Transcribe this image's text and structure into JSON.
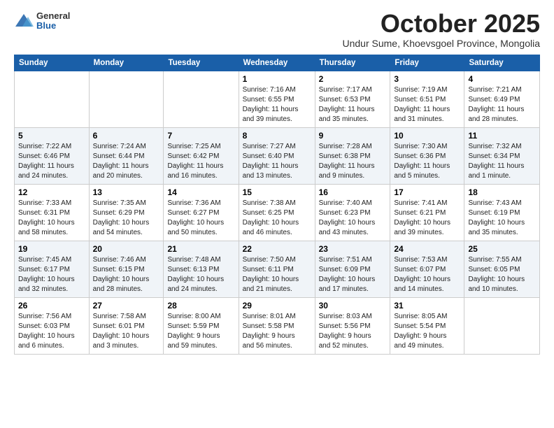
{
  "logo": {
    "general": "General",
    "blue": "Blue"
  },
  "title": "October 2025",
  "subtitle": "Undur Sume, Khoevsgoel Province, Mongolia",
  "weekdays": [
    "Sunday",
    "Monday",
    "Tuesday",
    "Wednesday",
    "Thursday",
    "Friday",
    "Saturday"
  ],
  "weeks": [
    [
      {
        "day": "",
        "info": ""
      },
      {
        "day": "",
        "info": ""
      },
      {
        "day": "",
        "info": ""
      },
      {
        "day": "1",
        "info": "Sunrise: 7:16 AM\nSunset: 6:55 PM\nDaylight: 11 hours\nand 39 minutes."
      },
      {
        "day": "2",
        "info": "Sunrise: 7:17 AM\nSunset: 6:53 PM\nDaylight: 11 hours\nand 35 minutes."
      },
      {
        "day": "3",
        "info": "Sunrise: 7:19 AM\nSunset: 6:51 PM\nDaylight: 11 hours\nand 31 minutes."
      },
      {
        "day": "4",
        "info": "Sunrise: 7:21 AM\nSunset: 6:49 PM\nDaylight: 11 hours\nand 28 minutes."
      }
    ],
    [
      {
        "day": "5",
        "info": "Sunrise: 7:22 AM\nSunset: 6:46 PM\nDaylight: 11 hours\nand 24 minutes."
      },
      {
        "day": "6",
        "info": "Sunrise: 7:24 AM\nSunset: 6:44 PM\nDaylight: 11 hours\nand 20 minutes."
      },
      {
        "day": "7",
        "info": "Sunrise: 7:25 AM\nSunset: 6:42 PM\nDaylight: 11 hours\nand 16 minutes."
      },
      {
        "day": "8",
        "info": "Sunrise: 7:27 AM\nSunset: 6:40 PM\nDaylight: 11 hours\nand 13 minutes."
      },
      {
        "day": "9",
        "info": "Sunrise: 7:28 AM\nSunset: 6:38 PM\nDaylight: 11 hours\nand 9 minutes."
      },
      {
        "day": "10",
        "info": "Sunrise: 7:30 AM\nSunset: 6:36 PM\nDaylight: 11 hours\nand 5 minutes."
      },
      {
        "day": "11",
        "info": "Sunrise: 7:32 AM\nSunset: 6:34 PM\nDaylight: 11 hours\nand 1 minute."
      }
    ],
    [
      {
        "day": "12",
        "info": "Sunrise: 7:33 AM\nSunset: 6:31 PM\nDaylight: 10 hours\nand 58 minutes."
      },
      {
        "day": "13",
        "info": "Sunrise: 7:35 AM\nSunset: 6:29 PM\nDaylight: 10 hours\nand 54 minutes."
      },
      {
        "day": "14",
        "info": "Sunrise: 7:36 AM\nSunset: 6:27 PM\nDaylight: 10 hours\nand 50 minutes."
      },
      {
        "day": "15",
        "info": "Sunrise: 7:38 AM\nSunset: 6:25 PM\nDaylight: 10 hours\nand 46 minutes."
      },
      {
        "day": "16",
        "info": "Sunrise: 7:40 AM\nSunset: 6:23 PM\nDaylight: 10 hours\nand 43 minutes."
      },
      {
        "day": "17",
        "info": "Sunrise: 7:41 AM\nSunset: 6:21 PM\nDaylight: 10 hours\nand 39 minutes."
      },
      {
        "day": "18",
        "info": "Sunrise: 7:43 AM\nSunset: 6:19 PM\nDaylight: 10 hours\nand 35 minutes."
      }
    ],
    [
      {
        "day": "19",
        "info": "Sunrise: 7:45 AM\nSunset: 6:17 PM\nDaylight: 10 hours\nand 32 minutes."
      },
      {
        "day": "20",
        "info": "Sunrise: 7:46 AM\nSunset: 6:15 PM\nDaylight: 10 hours\nand 28 minutes."
      },
      {
        "day": "21",
        "info": "Sunrise: 7:48 AM\nSunset: 6:13 PM\nDaylight: 10 hours\nand 24 minutes."
      },
      {
        "day": "22",
        "info": "Sunrise: 7:50 AM\nSunset: 6:11 PM\nDaylight: 10 hours\nand 21 minutes."
      },
      {
        "day": "23",
        "info": "Sunrise: 7:51 AM\nSunset: 6:09 PM\nDaylight: 10 hours\nand 17 minutes."
      },
      {
        "day": "24",
        "info": "Sunrise: 7:53 AM\nSunset: 6:07 PM\nDaylight: 10 hours\nand 14 minutes."
      },
      {
        "day": "25",
        "info": "Sunrise: 7:55 AM\nSunset: 6:05 PM\nDaylight: 10 hours\nand 10 minutes."
      }
    ],
    [
      {
        "day": "26",
        "info": "Sunrise: 7:56 AM\nSunset: 6:03 PM\nDaylight: 10 hours\nand 6 minutes."
      },
      {
        "day": "27",
        "info": "Sunrise: 7:58 AM\nSunset: 6:01 PM\nDaylight: 10 hours\nand 3 minutes."
      },
      {
        "day": "28",
        "info": "Sunrise: 8:00 AM\nSunset: 5:59 PM\nDaylight: 9 hours\nand 59 minutes."
      },
      {
        "day": "29",
        "info": "Sunrise: 8:01 AM\nSunset: 5:58 PM\nDaylight: 9 hours\nand 56 minutes."
      },
      {
        "day": "30",
        "info": "Sunrise: 8:03 AM\nSunset: 5:56 PM\nDaylight: 9 hours\nand 52 minutes."
      },
      {
        "day": "31",
        "info": "Sunrise: 8:05 AM\nSunset: 5:54 PM\nDaylight: 9 hours\nand 49 minutes."
      },
      {
        "day": "",
        "info": ""
      }
    ]
  ]
}
